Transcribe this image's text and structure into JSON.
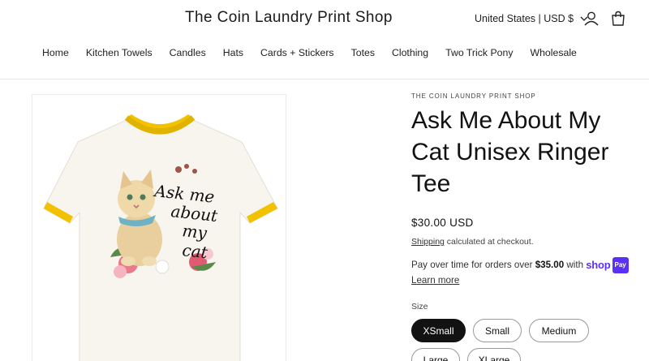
{
  "header": {
    "site_title": "The Coin Laundry Print Shop",
    "country_selector": "United States | USD $",
    "account_icon": "account-icon",
    "cart_icon": "cart-icon"
  },
  "nav": {
    "items": [
      "Home",
      "Kitchen Towels",
      "Candles",
      "Hats",
      "Cards + Stickers",
      "Totes",
      "Clothing",
      "Two Trick Pony",
      "Wholesale"
    ]
  },
  "product": {
    "vendor": "THE COIN LAUNDRY PRINT SHOP",
    "title": "Ask Me About My Cat Unisex Ringer Tee",
    "price": "$30.00 USD",
    "shipping_link": "Shipping",
    "shipping_text": " calculated at checkout.",
    "installments_text": "Pay over time for orders over ",
    "installments_amount": "$35.00",
    "installments_with": " with ",
    "shop_pay_word": "shop",
    "shop_pay_badge": "Pay",
    "learn_more": "Learn more",
    "size_label": "Size",
    "sizes": [
      "XSmall",
      "Small",
      "Medium",
      "Large",
      "XLarge"
    ],
    "selected_size": "XSmall",
    "image_text": [
      "Ask me",
      "about",
      "my",
      "cat"
    ]
  },
  "colors": {
    "ringer_yellow": "#f2c200",
    "shirt": "#f7f5ee",
    "shop_pay": "#5a31f4",
    "selected_pill": "#121212"
  }
}
